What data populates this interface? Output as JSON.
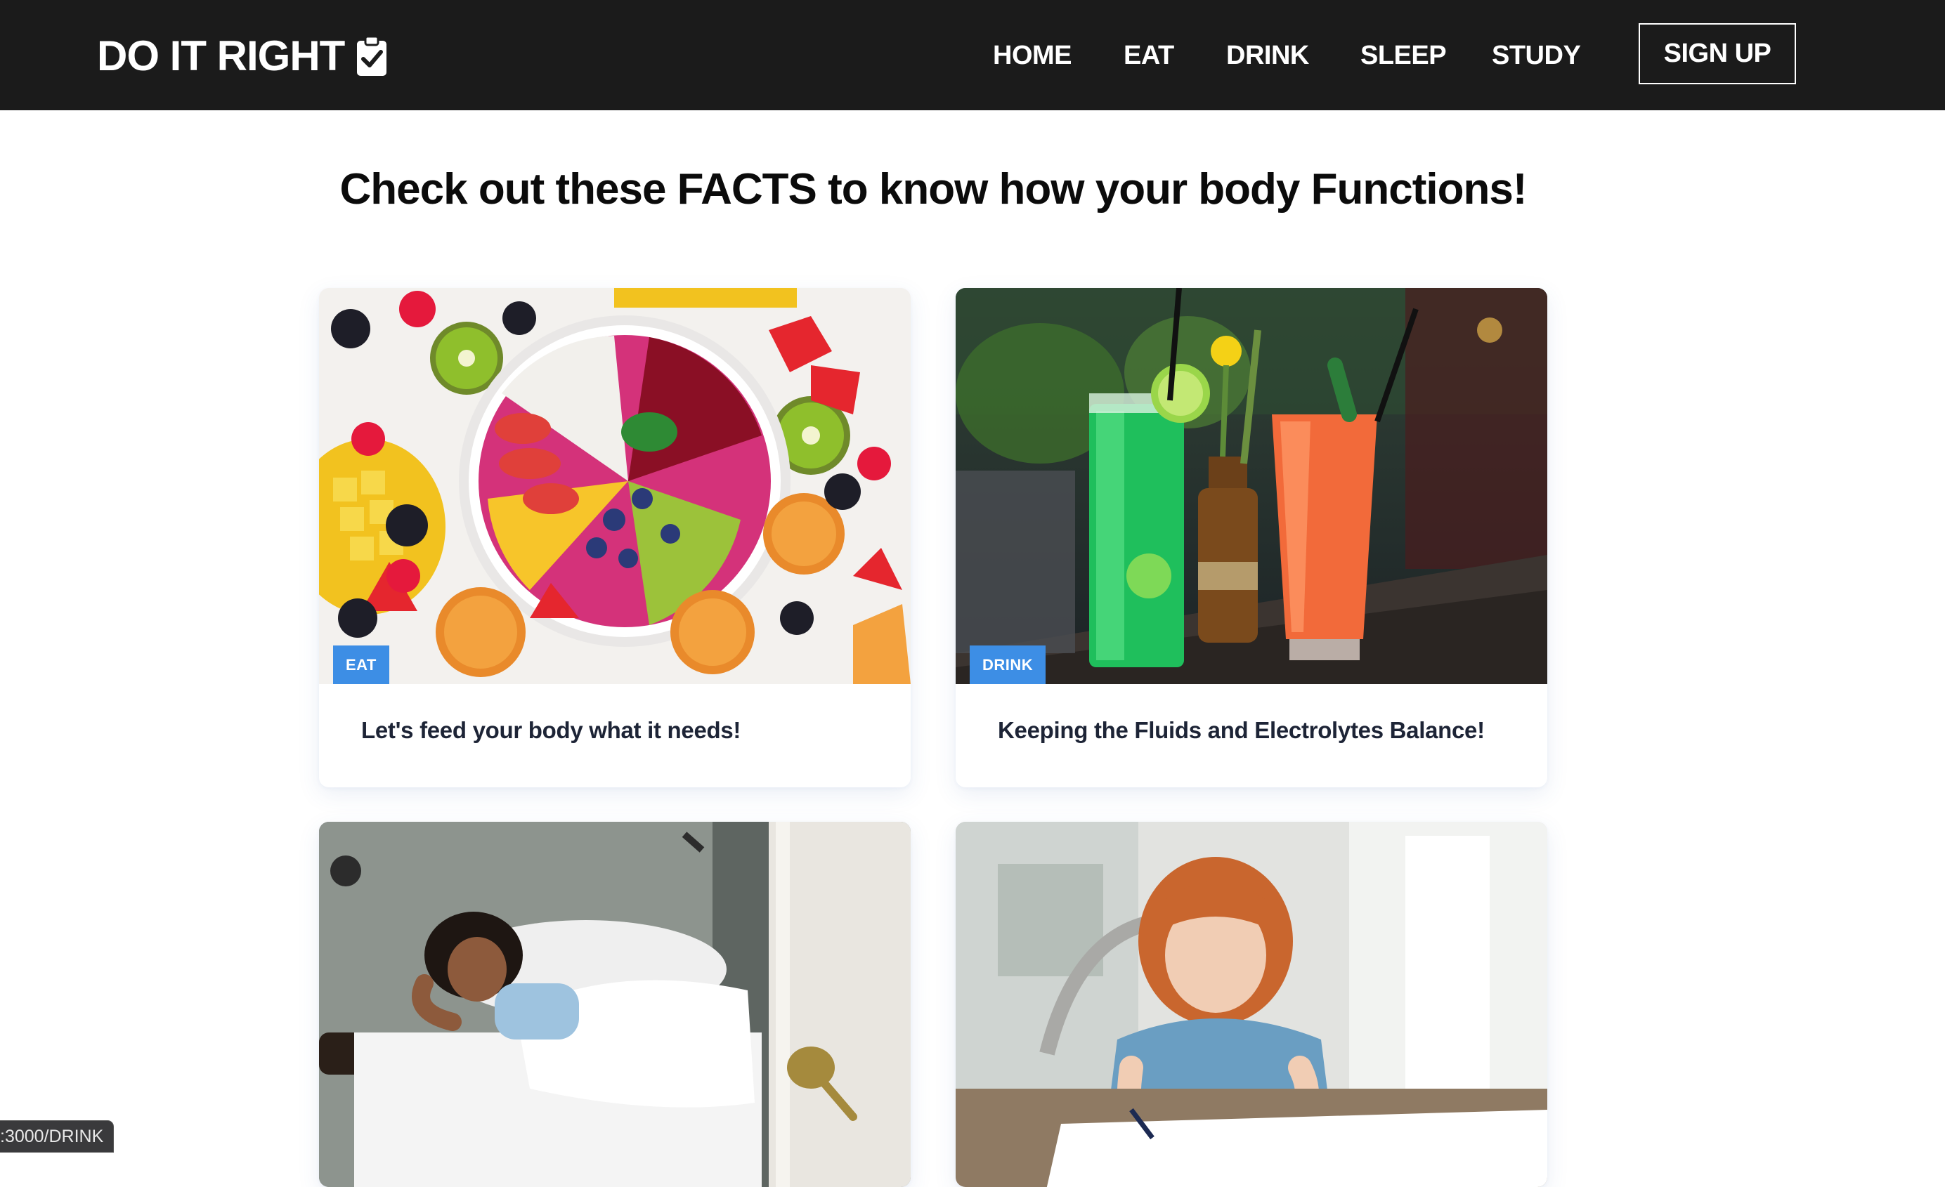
{
  "brand": {
    "name": "DO IT RIGHT",
    "icon": "clipboard-check-icon"
  },
  "nav": {
    "items": [
      {
        "label": "HOME"
      },
      {
        "label": "EAT"
      },
      {
        "label": "DRINK"
      },
      {
        "label": "SLEEP"
      },
      {
        "label": "STUDY"
      }
    ],
    "signup_label": "SIGN UP"
  },
  "main": {
    "heading": "Check out these FACTS to know how your body Functions!"
  },
  "cards": [
    {
      "tag": "EAT",
      "title": "Let's feed your body what it needs!",
      "image": "fruit-bowl-photo"
    },
    {
      "tag": "DRINK",
      "title": "Keeping the Fluids and Electrolytes Balance!",
      "image": "drinks-photo"
    },
    {
      "image": "sleeping-woman-photo"
    },
    {
      "image": "studying-girl-photo"
    }
  ],
  "status": {
    "url": ":3000/DRINK"
  },
  "colors": {
    "navbar": "#1b1b1b",
    "tag": "#3d8ee5",
    "card_title": "#1d2436"
  }
}
